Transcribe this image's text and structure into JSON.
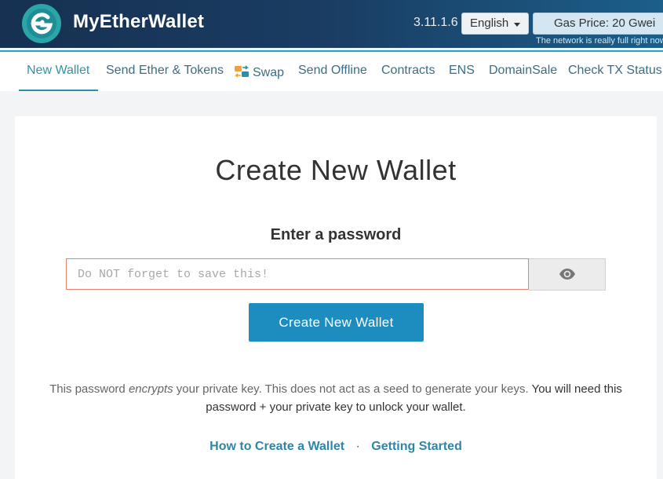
{
  "header": {
    "brand": "MyEtherWallet",
    "version": "3.11.1.6",
    "language": "English",
    "gas_price": "Gas Price: 20 Gwei",
    "network_note": "The network is really full right now.",
    "colors": {
      "brand_teal": "#2ba6a8",
      "header_dark": "#163151"
    }
  },
  "nav": {
    "items": [
      {
        "label": "New Wallet",
        "active": true
      },
      {
        "label": "Send Ether & Tokens"
      },
      {
        "label": "Swap",
        "icon": "swap-icon"
      },
      {
        "label": "Send Offline"
      },
      {
        "label": "Contracts"
      },
      {
        "label": "ENS"
      },
      {
        "label": "DomainSale"
      },
      {
        "label": "Check TX Status"
      }
    ]
  },
  "main": {
    "title": "Create New Wallet",
    "password_heading": "Enter a password",
    "password_placeholder": "Do NOT forget to save this!",
    "password_value": "",
    "show_password_icon": "eye-icon",
    "create_button": "Create New Wallet",
    "info": {
      "part1": "This password ",
      "part2": "encrypts",
      "part3": " your private key. This does not act as a seed to generate your keys. ",
      "part4": "You will need this password + your private key to unlock your wallet."
    },
    "links": {
      "how_to": "How to Create a Wallet",
      "separator": "·",
      "getting_started": "Getting Started"
    },
    "colors": {
      "button": "#1d8cbe",
      "link": "#2e86a7",
      "input_border": "#e4826f"
    }
  }
}
